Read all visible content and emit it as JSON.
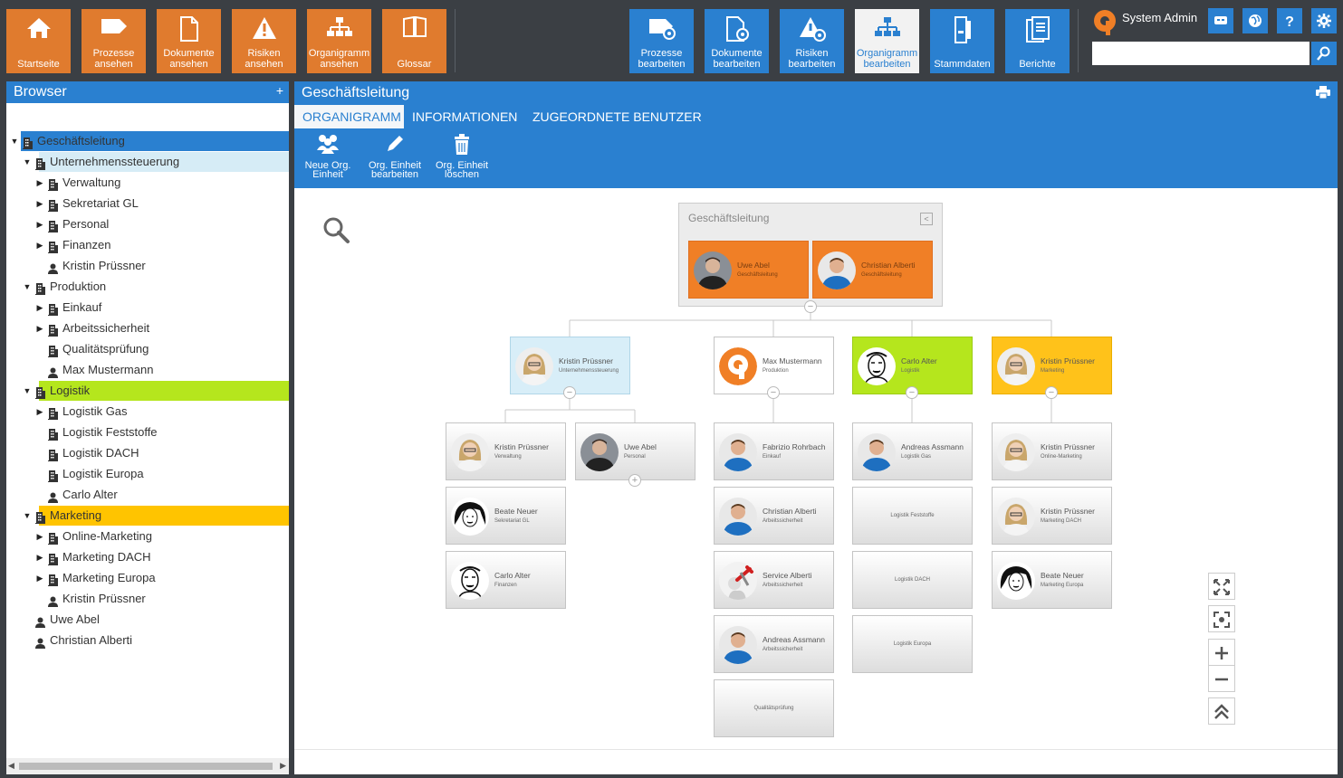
{
  "topbar": {
    "left_buttons": [
      {
        "label": "Startseite",
        "icon": "home-icon"
      },
      {
        "label": "Prozesse\nansehen",
        "icon": "tag-icon"
      },
      {
        "label": "Dokumente\nansehen",
        "icon": "document-icon"
      },
      {
        "label": "Risiken\nansehen",
        "icon": "warning-icon"
      },
      {
        "label": "Organigramm\nansehen",
        "icon": "org-chart-icon"
      },
      {
        "label": "Glossar",
        "icon": "book-icon"
      }
    ],
    "right_buttons": [
      {
        "label": "Prozesse\nbearbeiten",
        "icon": "tag-gear-icon"
      },
      {
        "label": "Dokumente\nbearbeiten",
        "icon": "document-gear-icon"
      },
      {
        "label": "Risiken\nbearbeiten",
        "icon": "warning-gear-icon"
      },
      {
        "label": "Organigramm\nbearbeiten",
        "icon": "org-chart-icon"
      },
      {
        "label": "Stammdaten",
        "icon": "database-icon"
      },
      {
        "label": "Berichte",
        "icon": "report-icon"
      }
    ],
    "user_name": "System Admin",
    "search_placeholder": "",
    "colors": {
      "orange": "#e07b2e",
      "blue": "#2a80d0",
      "dark": "#3b3f44"
    }
  },
  "sidebar": {
    "title": "Browser",
    "add_label": "+",
    "tree": [
      {
        "label": "Geschäftsleitung",
        "level": 0,
        "toggle": "▼",
        "icon": "building-icon",
        "highlight": "blue"
      },
      {
        "label": "Unternehmenssteuerung",
        "level": 1,
        "toggle": "▼",
        "icon": "building-icon",
        "highlight": "lblue"
      },
      {
        "label": "Verwaltung",
        "level": 2,
        "toggle": "▶",
        "icon": "building-icon"
      },
      {
        "label": "Sekretariat GL",
        "level": 2,
        "toggle": "▶",
        "icon": "building-icon"
      },
      {
        "label": "Personal",
        "level": 2,
        "toggle": "▶",
        "icon": "building-icon"
      },
      {
        "label": "Finanzen",
        "level": 2,
        "toggle": "▶",
        "icon": "building-icon"
      },
      {
        "label": "Kristin Prüssner",
        "level": 2,
        "toggle": "",
        "icon": "person-icon"
      },
      {
        "label": "Produktion",
        "level": 1,
        "toggle": "▼",
        "icon": "building-icon"
      },
      {
        "label": "Einkauf",
        "level": 2,
        "toggle": "▶",
        "icon": "building-icon"
      },
      {
        "label": "Arbeitssicherheit",
        "level": 2,
        "toggle": "▶",
        "icon": "building-icon"
      },
      {
        "label": "Qualitätsprüfung",
        "level": 2,
        "toggle": "",
        "icon": "building-icon"
      },
      {
        "label": "Max Mustermann",
        "level": 2,
        "toggle": "",
        "icon": "person-icon"
      },
      {
        "label": "Logistik",
        "level": 1,
        "toggle": "▼",
        "icon": "building-icon",
        "highlight": "green"
      },
      {
        "label": "Logistik Gas",
        "level": 2,
        "toggle": "▶",
        "icon": "building-icon"
      },
      {
        "label": "Logistik Feststoffe",
        "level": 2,
        "toggle": "",
        "icon": "building-icon"
      },
      {
        "label": "Logistik DACH",
        "level": 2,
        "toggle": "",
        "icon": "building-icon"
      },
      {
        "label": "Logistik Europa",
        "level": 2,
        "toggle": "",
        "icon": "building-icon"
      },
      {
        "label": "Carlo Alter",
        "level": 2,
        "toggle": "",
        "icon": "person-icon"
      },
      {
        "label": "Marketing",
        "level": 1,
        "toggle": "▼",
        "icon": "building-icon",
        "highlight": "yellow"
      },
      {
        "label": "Online-Marketing",
        "level": 2,
        "toggle": "▶",
        "icon": "building-icon"
      },
      {
        "label": "Marketing DACH",
        "level": 2,
        "toggle": "▶",
        "icon": "building-icon"
      },
      {
        "label": "Marketing Europa",
        "level": 2,
        "toggle": "▶",
        "icon": "building-icon"
      },
      {
        "label": "Kristin Prüssner",
        "level": 2,
        "toggle": "",
        "icon": "person-icon"
      },
      {
        "label": "Uwe Abel",
        "level": 1,
        "toggle": "",
        "icon": "person-icon"
      },
      {
        "label": "Christian Alberti",
        "level": 1,
        "toggle": "",
        "icon": "person-icon"
      }
    ]
  },
  "main": {
    "title": "Geschäftsleitung",
    "tabs": [
      {
        "label": "ORGANIGRAMM",
        "active": true
      },
      {
        "label": "INFORMATIONEN",
        "active": false
      },
      {
        "label": "ZUGEORDNETE BENUTZER",
        "active": false
      }
    ],
    "toolbar": [
      {
        "label": "Neue Org.\nEinheit",
        "icon": "users-add-icon"
      },
      {
        "label": "Org. Einheit\nbearbeiten",
        "icon": "pencil-icon"
      },
      {
        "label": "Org. Einheit\nlöschen",
        "icon": "trash-icon"
      }
    ]
  },
  "orgchart": {
    "root": {
      "title": "Geschäftsleitung",
      "collapse_symbol": "<",
      "members": [
        {
          "name": "Uwe Abel",
          "role": "Geschäftsleitung",
          "color": "orange",
          "avatar": "man-dark"
        },
        {
          "name": "Christian Alberti",
          "role": "Geschäftsleitung",
          "color": "orange",
          "avatar": "man-blue"
        }
      ]
    },
    "level1": [
      {
        "name": "Kristin Prüssner",
        "role": "Unternehmenssteuerung",
        "color": "lblue",
        "avatar": "woman"
      },
      {
        "name": "Max Mustermann",
        "role": "Produktion",
        "color": "white",
        "avatar": "logo"
      },
      {
        "name": "Carlo Alter",
        "role": "Logistik",
        "color": "green",
        "avatar": "sketch-man"
      },
      {
        "name": "Kristin Prüssner",
        "role": "Marketing",
        "color": "yellow",
        "avatar": "woman"
      }
    ],
    "level2_col0": [
      {
        "name": "Kristin Prüssner",
        "role": "Verwaltung",
        "avatar": "woman"
      },
      {
        "name": "Beate Neuer",
        "role": "Sekretariat GL",
        "avatar": "sketch-woman"
      },
      {
        "name": "Carlo Alter",
        "role": "Finanzen",
        "avatar": "sketch-man"
      }
    ],
    "level2_col1": [
      {
        "name": "Uwe Abel",
        "role": "Personal",
        "avatar": "man-dark"
      }
    ],
    "level2_col2": [
      {
        "name": "Fabrizio Rohrbach",
        "role": "Einkauf",
        "avatar": "man-blue"
      },
      {
        "name": "Christian Alberti",
        "role": "Arbeitssicherheit",
        "avatar": "man-blue"
      },
      {
        "name": "Service Alberti",
        "role": "Arbeitssicherheit",
        "avatar": "tools"
      },
      {
        "name": "Andreas Assmann",
        "role": "Arbeitssicherheit",
        "avatar": "man-blue"
      },
      {
        "name": "",
        "role": "Qualitätsprüfung",
        "avatar": ""
      }
    ],
    "level2_col3": [
      {
        "name": "Andreas Assmann",
        "role": "Logistik Gas",
        "avatar": "man-blue"
      },
      {
        "name": "",
        "role": "Logistik Feststoffe",
        "avatar": ""
      },
      {
        "name": "",
        "role": "Logistik DACH",
        "avatar": ""
      },
      {
        "name": "",
        "role": "Logistik Europa",
        "avatar": ""
      }
    ],
    "level2_col4": [
      {
        "name": "Kristin Prüssner",
        "role": "Online-Marketing",
        "avatar": "woman"
      },
      {
        "name": "Kristin Prüssner",
        "role": "Marketing DACH",
        "avatar": "woman"
      },
      {
        "name": "Beate Neuer",
        "role": "Marketing Europa",
        "avatar": "sketch-woman"
      }
    ],
    "collapse_minus": "−",
    "expand_plus": "+"
  },
  "zoom_controls": {
    "fit_label": "fit-icon",
    "center_label": "center-icon",
    "zoom_in": "+",
    "zoom_out": "−",
    "top_label": "scroll-top-icon"
  }
}
